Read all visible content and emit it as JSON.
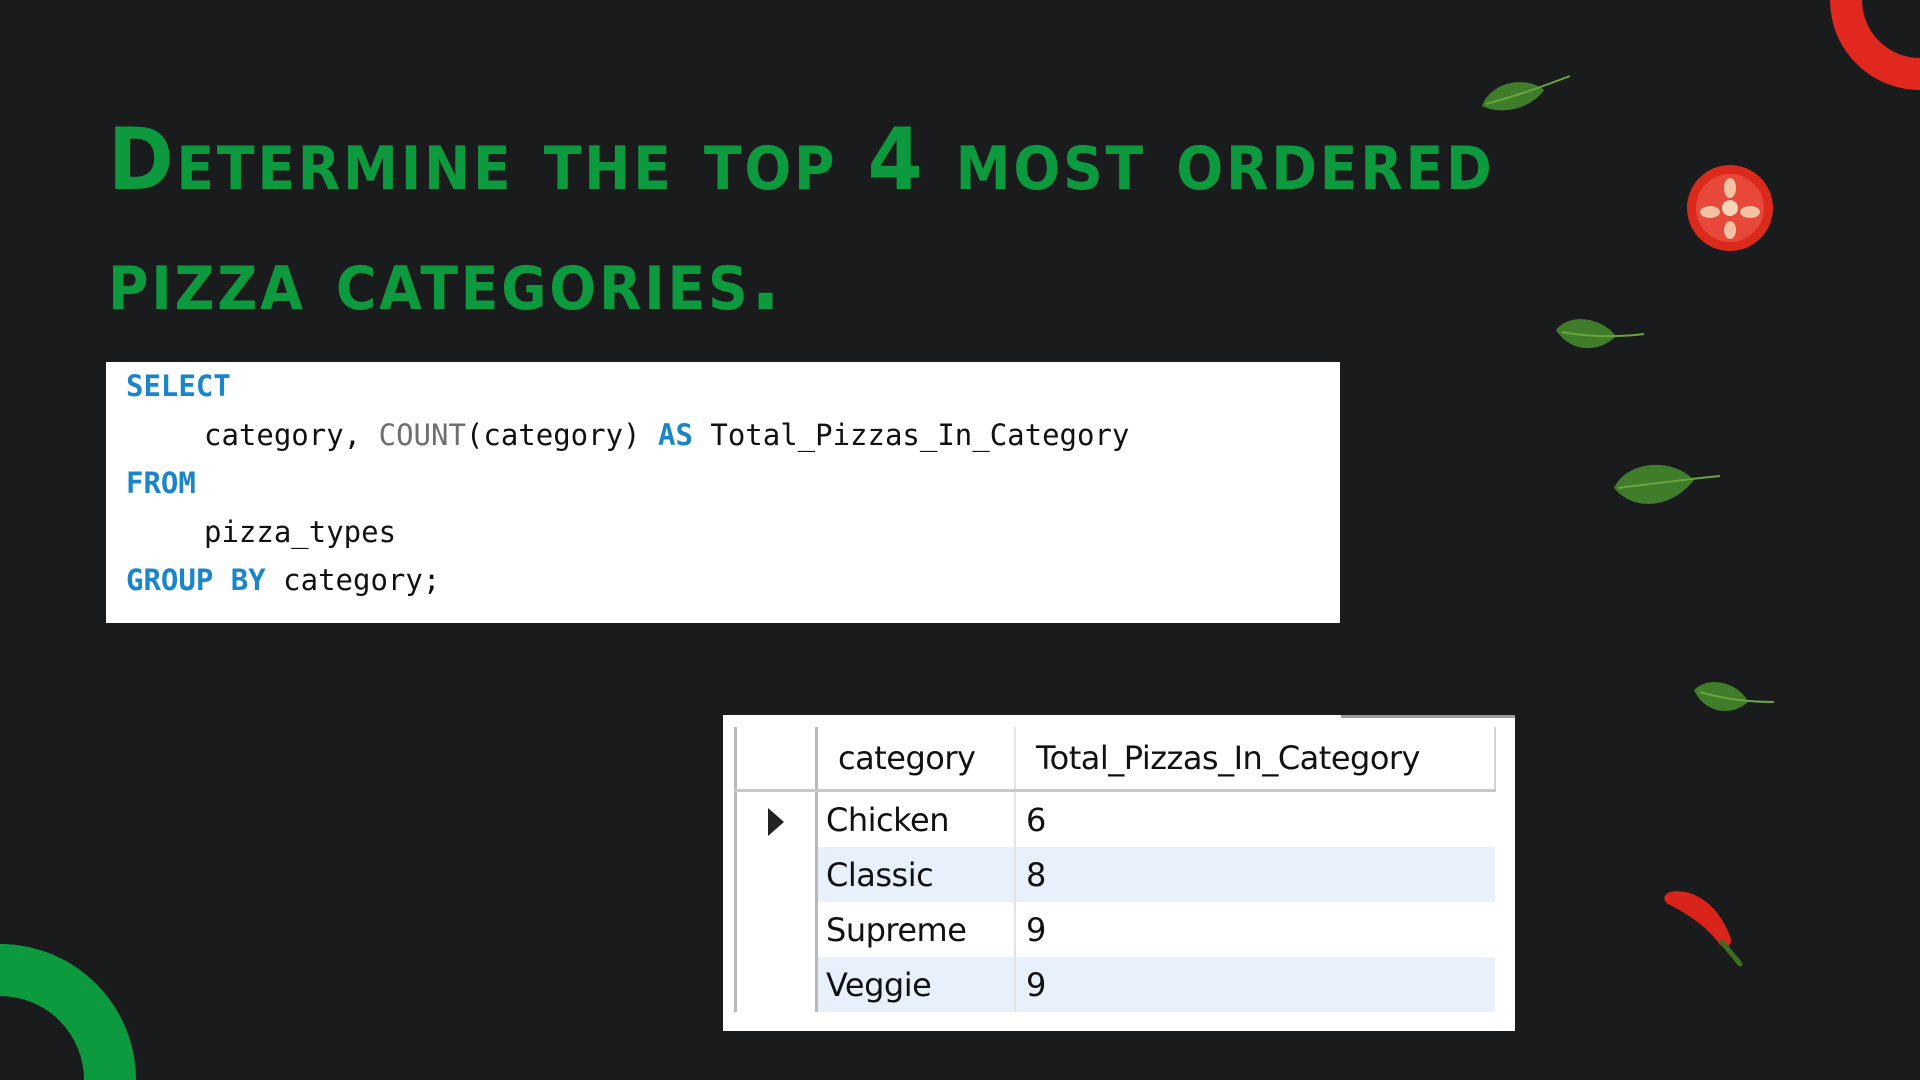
{
  "title": {
    "line1": "Determine the top 4 most ordered",
    "line2": "pizza categories."
  },
  "code": {
    "lines": [
      {
        "kw1": "SELECT"
      },
      {
        "t1": "category, ",
        "fn": "COUNT",
        "t2": "(category) ",
        "kw": "AS",
        "t3": " Total_Pizzas_In_Category"
      },
      {
        "kw1": "FROM"
      },
      {
        "t1": "pizza_types"
      },
      {
        "kw1": "GROUP BY",
        "t1": " category;"
      }
    ]
  },
  "result": {
    "headers": [
      "category",
      "Total_Pizzas_In_Category"
    ],
    "rows": [
      {
        "category": "Chicken",
        "total": "6"
      },
      {
        "category": "Classic",
        "total": "8"
      },
      {
        "category": "Supreme",
        "total": "9"
      },
      {
        "category": "Veggie",
        "total": "9"
      }
    ]
  },
  "colors": {
    "background": "#1a1b1d",
    "title": "#0d9a3e",
    "keyword": "#1a86c9",
    "accent_red": "#e0281e",
    "accent_green": "#0d9a3e"
  },
  "icons": [
    "basil-leaf-icon",
    "tomato-icon",
    "chili-pepper-icon"
  ]
}
